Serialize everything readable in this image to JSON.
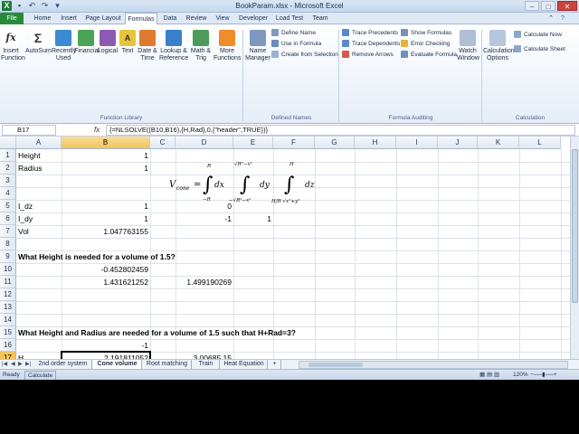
{
  "window": {
    "title": "BookParam.xlsx - Microsoft Excel"
  },
  "tabs": [
    "File",
    "Home",
    "Insert",
    "Page Layout",
    "Formulas",
    "Data",
    "Review",
    "View",
    "Developer",
    "Load Test",
    "Team"
  ],
  "ribbon": {
    "function_library": {
      "label": "Function Library",
      "buttons": [
        {
          "line1": "Insert",
          "line2": "Function",
          "icon": "fx-icon"
        },
        {
          "line1": "AutoSum",
          "line2": "",
          "icon": "sigma-icon"
        },
        {
          "line1": "Recently",
          "line2": "Used",
          "icon": "book-icon"
        },
        {
          "line1": "Financial",
          "line2": "",
          "icon": "book-icon"
        },
        {
          "line1": "Logical",
          "line2": "",
          "icon": "book-icon"
        },
        {
          "line1": "Text",
          "line2": "",
          "icon": "book-icon"
        },
        {
          "line1": "Date &",
          "line2": "Time",
          "icon": "book-icon"
        },
        {
          "line1": "Lookup &",
          "line2": "Reference",
          "icon": "book-icon"
        },
        {
          "line1": "Math &",
          "line2": "Trig",
          "icon": "book-icon"
        },
        {
          "line1": "More",
          "line2": "Functions",
          "icon": "book-icon"
        }
      ]
    },
    "defined_names": {
      "label": "Defined Names",
      "name_manager": {
        "line1": "Name",
        "line2": "Manager"
      },
      "items": [
        "Define Name",
        "Use in Formula",
        "Create from Selection"
      ]
    },
    "formula_auditing": {
      "label": "Formula Auditing",
      "items": [
        "Trace Precedents",
        "Trace Dependents",
        "Remove Arrows",
        "Show Formulas",
        "Error Checking",
        "Evaluate Formula"
      ],
      "watch": {
        "line1": "Watch",
        "line2": "Window"
      }
    },
    "calculation": {
      "label": "Calculation",
      "options": {
        "line1": "Calculation",
        "line2": "Options"
      },
      "items": [
        "Calculate Now",
        "Calculate Sheet"
      ]
    }
  },
  "formula_bar": {
    "name_box": "B17",
    "fx": "fx",
    "formula": "{=NLSOLVE((B10,B16),{H,Rad},0,{\"header\",TRUE})}"
  },
  "columns": [
    "A",
    "B",
    "C",
    "D",
    "E",
    "F",
    "G",
    "H",
    "I",
    "J",
    "K",
    "L"
  ],
  "rows": [
    "1",
    "2",
    "3",
    "4",
    "5",
    "6",
    "7",
    "8",
    "9",
    "10",
    "11",
    "12",
    "13",
    "14",
    "15",
    "16",
    "17"
  ],
  "cells": {
    "A1": "Height",
    "B1": "1",
    "A2": "Radius",
    "B2": "1",
    "A5": "I_dz",
    "B5": "1",
    "D5": "0",
    "A6": "I_dy",
    "B6": "1",
    "D6": "-1",
    "E6": "1",
    "A7": "Vol",
    "B7": "1.047763155",
    "A9": "What Height is needed for a volume of 1.5?",
    "B10": "-0.452802459",
    "B11": "1.431621252",
    "D11": "1.499190269",
    "A15": "What Height and Radius are needed for a volume of 1.5 such that H+Rad=3?",
    "B16": "-1",
    "A17": "H",
    "B17": "2.191811052",
    "D17": "3.00685 15"
  },
  "equation": {
    "lhs": "V",
    "lhs_sub": "cone",
    "eq": "=",
    "int1_upper": "R",
    "int1_lower": "−R",
    "int1_var": "dx",
    "int2_upper": "√R²−x²",
    "int2_lower": "−√R²−x²",
    "int2_var": "dy",
    "int3_upper": "H",
    "int3_lower": "H/R √x²+y²",
    "int3_var": "dz"
  },
  "sheets": [
    "2nd order system",
    "Cone volume",
    "Root matching",
    "Train",
    "Heat Equation"
  ],
  "active_sheet": "Cone volume",
  "status": {
    "ready": "Ready",
    "calculate": "Calculate",
    "zoom": "120%"
  }
}
